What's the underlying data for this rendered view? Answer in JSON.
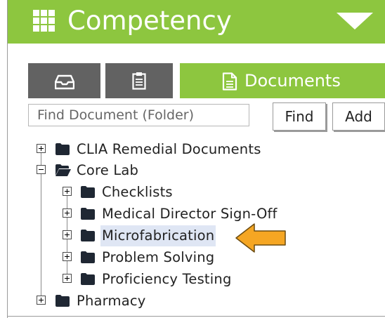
{
  "header": {
    "title": "Competency",
    "menu_icon": "grid-icon",
    "dropdown_icon": "caret-down-icon",
    "color": "#8dc63f"
  },
  "tabs": [
    {
      "icon": "inbox-tray-icon",
      "label": ""
    },
    {
      "icon": "clipboard-icon",
      "label": ""
    },
    {
      "icon": "document-icon",
      "label": "Documents",
      "active": true
    }
  ],
  "search": {
    "placeholder": "Find Document (Folder)",
    "find_label": "Find",
    "add_label": "Add"
  },
  "tree": {
    "root_items": [
      {
        "label": "CLIA Remedial Documents",
        "expanded": false
      },
      {
        "label": "Core Lab",
        "expanded": true,
        "children": [
          {
            "label": "Checklists",
            "expanded": false
          },
          {
            "label": "Medical Director Sign-Off",
            "expanded": false
          },
          {
            "label": "Microfabrication",
            "expanded": false,
            "selected": true
          },
          {
            "label": "Problem Solving",
            "expanded": false
          },
          {
            "label": "Proficiency Testing",
            "expanded": false
          }
        ]
      },
      {
        "label": "Pharmacy",
        "expanded": false
      }
    ]
  },
  "annotation": {
    "icon": "pointer-arrow-icon",
    "color": "#f5a623"
  },
  "colors": {
    "accent": "#8dc63f",
    "tab_inactive": "#626262",
    "selection": "#dfe6f4"
  }
}
